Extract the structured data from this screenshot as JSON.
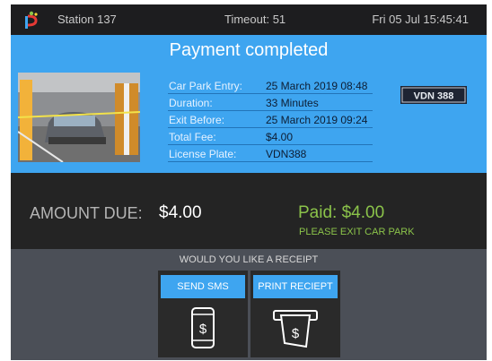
{
  "topbar": {
    "station": "Station 137",
    "timeout": "Timeout: 51",
    "datetime": "Fri 05 Jul 15:45:41"
  },
  "payment": {
    "title": "Payment completed",
    "plate_image_text": "VDN 388",
    "details": [
      {
        "label": "Car Park Entry:",
        "value": "25 March 2019 08:48"
      },
      {
        "label": "Duration:",
        "value": "33 Minutes"
      },
      {
        "label": "Exit Before:",
        "value": "25 March 2019 09:24"
      },
      {
        "label": "Total Fee:",
        "value": "$4.00"
      },
      {
        "label": "License Plate:",
        "value": "VDN388"
      }
    ]
  },
  "amount": {
    "due_label": "AMOUNT DUE:",
    "due_value": "$4.00",
    "paid": "Paid: $4.00",
    "exit_message": "PLEASE EXIT CAR PARK"
  },
  "receipt": {
    "question": "WOULD YOU LIKE A RECEIPT",
    "sms_label": "SEND SMS",
    "print_label": "PRINT RECIEPT",
    "sms_icon": "phone-dollar-icon",
    "print_icon": "printer-receipt-dollar-icon"
  },
  "colors": {
    "accent_blue": "#3ea5f0",
    "paid_green": "#8bc34a",
    "dark_bg": "#2b2b2d"
  }
}
